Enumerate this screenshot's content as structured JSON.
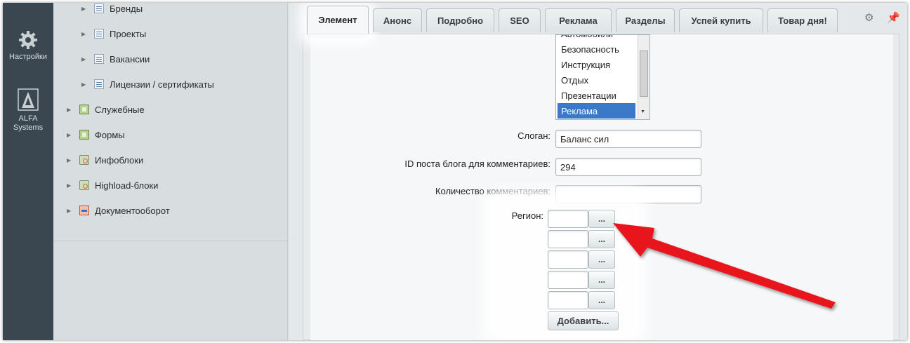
{
  "appbar": {
    "settings_label": "Настройки",
    "alfa_label_line1": "ALFA",
    "alfa_label_line2": "Systems"
  },
  "tree": {
    "items": [
      {
        "label": "Бренды",
        "icon": "list-icon"
      },
      {
        "label": "Проекты",
        "icon": "list-icon"
      },
      {
        "label": "Вакансии",
        "icon": "list-icon"
      },
      {
        "label": "Лицензии / сертификаты",
        "icon": "list-icon"
      },
      {
        "label": "Служебные",
        "icon": "folder-icon"
      },
      {
        "label": "Формы",
        "icon": "folder-icon"
      },
      {
        "label": "Инфоблоки",
        "icon": "gear-folder-icon"
      },
      {
        "label": "Highload-блоки",
        "icon": "gear-folder-icon"
      },
      {
        "label": "Документооборот",
        "icon": "document-icon"
      }
    ]
  },
  "tabs": [
    {
      "label": "Элемент",
      "active": true
    },
    {
      "label": "Анонс"
    },
    {
      "label": "Подробно"
    },
    {
      "label": "SEO"
    },
    {
      "label": "Реклама"
    },
    {
      "label": "Разделы"
    },
    {
      "label": "Успей купить"
    },
    {
      "label": "Товар дня!"
    }
  ],
  "listbox": {
    "partial_top": "Автомобили",
    "items": [
      "Безопасность",
      "Инструкция",
      "Отдых",
      "Презентации",
      "Реклама"
    ],
    "selected": "Реклама"
  },
  "form": {
    "slogan_label": "Слоган:",
    "slogan_value": "Баланс сил",
    "blog_id_label": "ID поста блога для комментариев:",
    "blog_id_value": "294",
    "comments_label": "Количество комментариев:",
    "comments_value": "",
    "region_label": "Регион:",
    "region_button": "...",
    "add_button": "Добавить..."
  },
  "colors": {
    "accent_selection": "#3b78c7",
    "annotation_arrow": "#e8141c"
  }
}
